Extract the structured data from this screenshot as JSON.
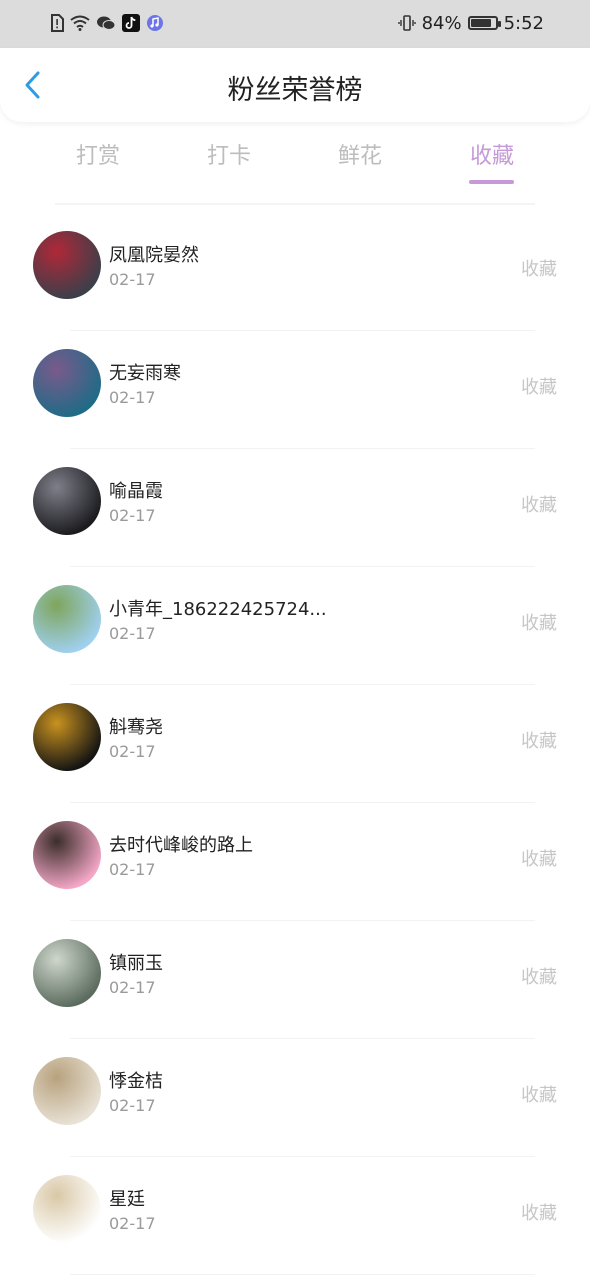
{
  "status_bar": {
    "battery": "84%",
    "time": "5:52",
    "battery_level": 0.84
  },
  "header": {
    "title": "粉丝荣誉榜"
  },
  "tabs": [
    {
      "label": "打赏"
    },
    {
      "label": "打卡"
    },
    {
      "label": "鲜花"
    },
    {
      "label": "收藏"
    }
  ],
  "active_tab": "收藏",
  "fans": [
    {
      "name": "凤凰院晏然",
      "date": "02-17",
      "action": "收藏",
      "avatar_colors": [
        "#3b3f4a",
        "#b02838"
      ]
    },
    {
      "name": "无妄雨寒",
      "date": "02-17",
      "action": "收藏",
      "avatar_colors": [
        "#1f6b86",
        "#7a5a8c"
      ]
    },
    {
      "name": "喻晶霞",
      "date": "02-17",
      "action": "收藏",
      "avatar_colors": [
        "#1b1b1f",
        "#7e7f89"
      ]
    },
    {
      "name": "小青年_186222425724...",
      "date": "02-17",
      "action": "收藏",
      "avatar_colors": [
        "#9fd0ef",
        "#7fa55c"
      ]
    },
    {
      "name": "斛骞尧",
      "date": "02-17",
      "action": "收藏",
      "avatar_colors": [
        "#141414",
        "#c9921f"
      ]
    },
    {
      "name": "去时代峰峻的路上",
      "date": "02-17",
      "action": "收藏",
      "avatar_colors": [
        "#f4a7c7",
        "#3b2e2a"
      ]
    },
    {
      "name": "镇丽玉",
      "date": "02-17",
      "action": "收藏",
      "avatar_colors": [
        "#5b6b5e",
        "#cfd7cc"
      ]
    },
    {
      "name": "悸金桔",
      "date": "02-17",
      "action": "收藏",
      "avatar_colors": [
        "#e8e2d6",
        "#b8a27e"
      ]
    },
    {
      "name": "星廷",
      "date": "02-17",
      "action": "收藏",
      "avatar_colors": [
        "#ffffff",
        "#d9c8a7"
      ]
    }
  ],
  "colors": {
    "accent": "#c69ad8",
    "inactive_tab": "#bdbdbd",
    "back_arrow": "#2f9be6"
  },
  "icons": {
    "back": "chevron-left-icon"
  }
}
